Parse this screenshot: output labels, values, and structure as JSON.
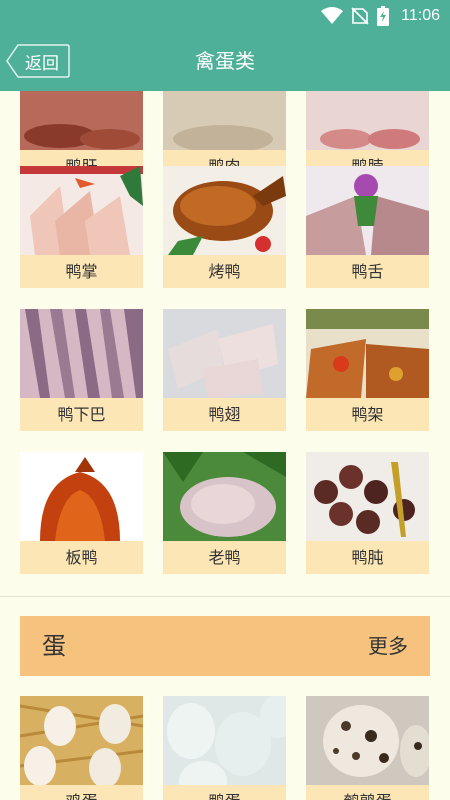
{
  "status_bar": {
    "time": "11:06"
  },
  "app_bar": {
    "back_label": "返回",
    "title": "禽蛋类"
  },
  "cards_top_row": [
    "鸭肝",
    "鸭肉",
    "鸭脖"
  ],
  "cards": [
    {
      "label": "鸭掌",
      "image": "duck-feet-photo"
    },
    {
      "label": "烤鸭",
      "image": "roast-duck-photo"
    },
    {
      "label": "鸭舌",
      "image": "duck-tongue-photo"
    },
    {
      "label": "鸭下巴",
      "image": "duck-chin-photo"
    },
    {
      "label": "鸭翅",
      "image": "duck-wing-photo"
    },
    {
      "label": "鸭架",
      "image": "duck-frame-photo"
    },
    {
      "label": "板鸭",
      "image": "pressed-duck-photo"
    },
    {
      "label": "老鸭",
      "image": "old-duck-photo"
    },
    {
      "label": "鸭肫",
      "image": "duck-gizzard-photo"
    }
  ],
  "egg_section": {
    "title": "蛋",
    "more_label": "更多",
    "items": [
      "鸡蛋",
      "鸭蛋",
      "鹌鹑蛋"
    ]
  },
  "colors": {
    "primary": "#4fb09a",
    "background": "#fdfdeb",
    "label_bg": "#fde6b6",
    "section_bg": "#f6c37e"
  }
}
